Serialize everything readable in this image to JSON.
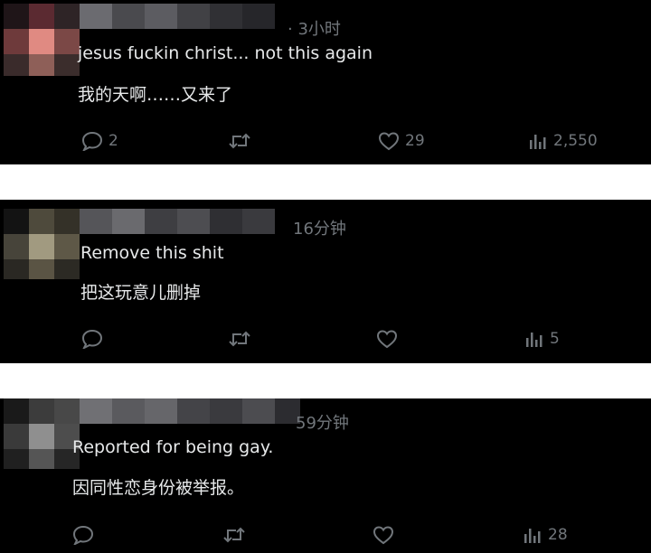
{
  "comments": [
    {
      "time": "· 3小时",
      "text_en": "jesus fuckin christ... not this again",
      "text_zh": "我的天啊……又来了",
      "replies": "2",
      "retweets": "",
      "likes": "29",
      "views": "2,550"
    },
    {
      "time": "16分钟",
      "text_en": "Remove this shit",
      "text_zh": "把这玩意儿删掉",
      "replies": "",
      "retweets": "",
      "likes": "",
      "views": "5"
    },
    {
      "time": "59分钟",
      "text_en": "Reported for being gay.",
      "text_zh": "因同性恋身份被举报。",
      "replies": "",
      "retweets": "",
      "likes": "",
      "views": "28"
    }
  ],
  "colors": {
    "background": "#000000",
    "text": "#e7e9ea",
    "muted": "#71767b"
  }
}
